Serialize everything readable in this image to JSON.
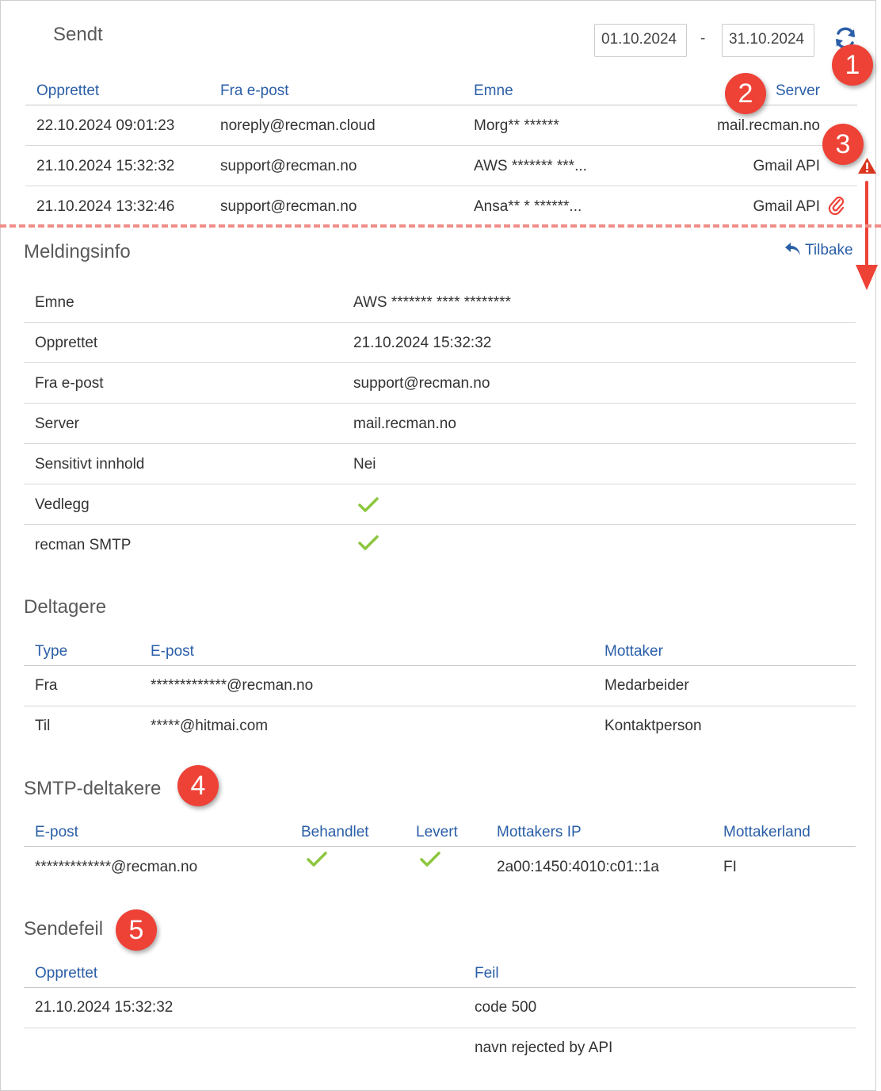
{
  "header": {
    "title": "Sendt",
    "date_from": "01.10.2024",
    "date_separator": "-",
    "date_to": "31.10.2024"
  },
  "list": {
    "columns": [
      "Opprettet",
      "Fra e-post",
      "Emne",
      "Server"
    ],
    "rows": [
      {
        "created": "22.10.2024 09:01:23",
        "from": "noreply@recman.cloud",
        "subject": "Morg** ******",
        "server": "mail.recman.no"
      },
      {
        "created": "21.10.2024 15:32:32",
        "from": "support@recman.no",
        "subject": "AWS ******* ***...",
        "server": "Gmail API"
      },
      {
        "created": "21.10.2024 13:32:46",
        "from": "support@recman.no",
        "subject": "Ansa** * ******...",
        "server": "Gmail API"
      }
    ]
  },
  "badges": [
    "1",
    "2",
    "3",
    "4",
    "5"
  ],
  "details": {
    "title": "Meldingsinfo",
    "back_label": "Tilbake",
    "rows": [
      {
        "label": "Emne",
        "value": "AWS ******* **** ********"
      },
      {
        "label": "Opprettet",
        "value": "21.10.2024 15:32:32"
      },
      {
        "label": "Fra e-post",
        "value": "support@recman.no"
      },
      {
        "label": "Server",
        "value": "mail.recman.no"
      },
      {
        "label": "Sensitivt innhold",
        "value": "Nei"
      },
      {
        "label": "Vedlegg",
        "value": "check"
      },
      {
        "label": "recman SMTP",
        "value": "check"
      }
    ]
  },
  "participants": {
    "title": "Deltagere",
    "columns": [
      "Type",
      "E-post",
      "Mottaker"
    ],
    "rows": [
      {
        "type": "Fra",
        "email": "*************@recman.no",
        "recipient": "Medarbeider"
      },
      {
        "type": "Til",
        "email": "*****@hitmai.com",
        "recipient": "Kontaktperson"
      }
    ]
  },
  "smtp": {
    "title": "SMTP-deltakere",
    "columns": [
      "E-post",
      "Behandlet",
      "Levert",
      "Mottakers IP",
      "Mottakerland"
    ],
    "rows": [
      {
        "email": "*************@recman.no",
        "processed": "check",
        "delivered": "check",
        "ip": "2a00:1450:4010:c01::1a",
        "country": "FI"
      }
    ]
  },
  "errors": {
    "title": "Sendefeil",
    "columns": [
      "Opprettet",
      "Feil"
    ],
    "rows": [
      {
        "created": "21.10.2024 15:32:32",
        "error": "code 500"
      },
      {
        "created": "",
        "error": "navn rejected by API"
      }
    ]
  },
  "colors": {
    "link": "#2a5ea7",
    "badge": "#ee4237",
    "check": "#8cc63f",
    "divider": "#f08d88",
    "warning": "#d9361f"
  },
  "icons": [
    "refresh-icon",
    "warning-icon",
    "attachment-icon",
    "reply-arrow-icon",
    "check-icon",
    "down-arrow-icon"
  ]
}
